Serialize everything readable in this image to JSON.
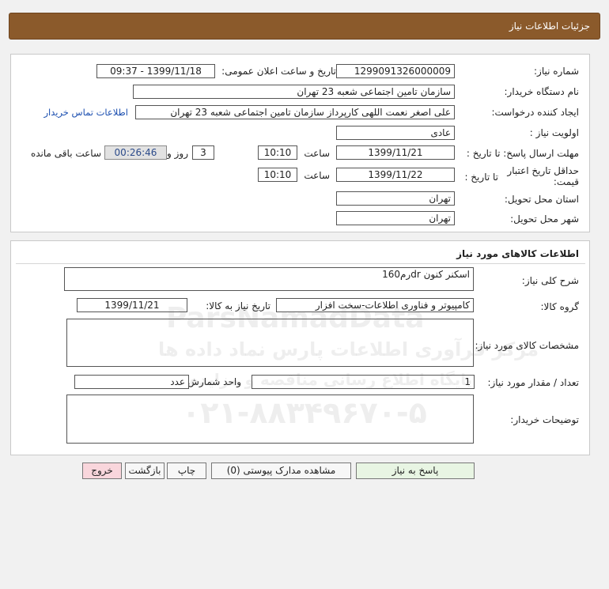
{
  "header": {
    "title": "جزئیات اطلاعات نیاز"
  },
  "labels": {
    "need_number": "شماره نیاز:",
    "announce_datetime": "تاریخ و ساعت اعلان عمومی:",
    "buyer_org": "نام دستگاه خریدار:",
    "requester": "ایجاد کننده درخواست:",
    "priority": "اولویت نیاز :",
    "reply_deadline": "مهلت ارسال پاسخ: تا تاریخ :",
    "time": "ساعت",
    "days_and": "روز و",
    "time_remaining": "ساعت باقی مانده",
    "price_validity": "حداقل تاریخ اعتبار قیمت:",
    "until_date": "تا تاریخ :",
    "delivery_province": "استان محل تحویل:",
    "delivery_city": "شهر محل تحویل:",
    "general_desc": "شرح کلی نیاز:",
    "goods_group": "گروه کالا:",
    "need_date": "تاریخ نیاز به کالا:",
    "goods_specs": "مشخصات کالای مورد نیاز:",
    "quantity": "تعداد / مقدار مورد نیاز:",
    "unit": "واحد شمارش:",
    "buyer_notes": "توضیحات خریدار:"
  },
  "values": {
    "need_number": "1299091326000009",
    "announce_datetime": "1399/11/18 - 09:37",
    "buyer_org": "سازمان تامین اجتماعی شعبه 23 تهران",
    "requester": "علی اصغر نعمت اللهی کارپرداز سازمان تامین اجتماعی شعبه 23 تهران",
    "priority": "عادی",
    "reply_date": "1399/11/21",
    "reply_time": "10:10",
    "days_remaining": "3",
    "time_remaining": "00:26:46",
    "validity_date": "1399/11/22",
    "validity_time": "10:10",
    "province": "تهران",
    "city": "تهران",
    "general_desc": "اسکنر کنون drرم160",
    "goods_group": "کامپیوتر و فناوری اطلاعات-سخت افزار",
    "need_date": "1399/11/21",
    "goods_specs": "",
    "quantity": "1",
    "unit": "عدد",
    "buyer_notes": ""
  },
  "links": {
    "buyer_contact": "اطلاعات تماس خریدار"
  },
  "sections": {
    "goods_info": "اطلاعات کالاهای مورد نیاز"
  },
  "buttons": {
    "reply": "پاسخ به نیاز",
    "view_attachments": "مشاهده مدارک پیوستی (0)",
    "print": "چاپ",
    "back": "بازگشت",
    "exit": "خروج"
  },
  "watermark": {
    "brand_en": "ParsNamadData",
    "brand_fa": "مرکز فرآوری اطلاعات پارس نماد داده ها",
    "tagline_fa": "پایگاه اطلاع رسانی مناقصه و مزایده",
    "phone": "۰۲۱-۸۸۳۴۹۶۷۰-۵"
  },
  "colors": {
    "header_bg": "#8b5a2b",
    "link": "#1c4fb0",
    "reply_button": "#e8f5e3",
    "exit_button": "#f9d6dc"
  }
}
